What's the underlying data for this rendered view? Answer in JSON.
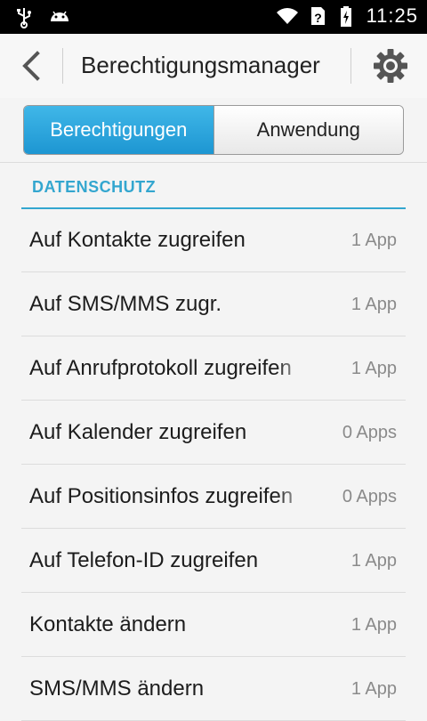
{
  "status_bar": {
    "time": "11:25",
    "icons_left": [
      "usb-icon",
      "android-icon"
    ],
    "icons_right": [
      "wifi-icon",
      "sim-unknown-icon",
      "battery-charging-icon"
    ]
  },
  "action_bar": {
    "title": "Berechtigungsmanager"
  },
  "tabs": [
    {
      "label": "Berechtigungen",
      "active": true
    },
    {
      "label": "Anwendung",
      "active": false
    }
  ],
  "section": {
    "header": "DATENSCHUTZ"
  },
  "permissions": [
    {
      "label": "Auf Kontakte zugreifen",
      "count": "1 App"
    },
    {
      "label": "Auf SMS/MMS zugr.",
      "count": "1 App"
    },
    {
      "label": "Auf Anrufprotokoll zugreifen",
      "count": "1 App"
    },
    {
      "label": "Auf Kalender zugreifen",
      "count": "0 Apps"
    },
    {
      "label": "Auf Positionsinfos zugreifen",
      "count": "0 Apps"
    },
    {
      "label": "Auf Telefon-ID zugreifen",
      "count": "1 App"
    },
    {
      "label": "Kontakte ändern",
      "count": "1 App"
    },
    {
      "label": "SMS/MMS ändern",
      "count": "1 App"
    }
  ],
  "colors": {
    "accent": "#33a6cf",
    "tab_active": "#2aa3dc",
    "status_bar": "#000000"
  }
}
